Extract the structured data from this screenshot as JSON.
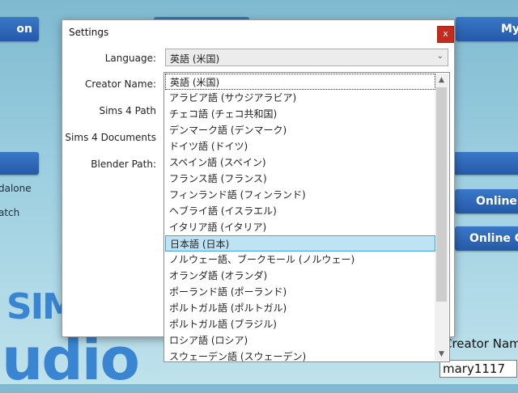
{
  "background": {
    "left_top_button": "on",
    "right_top_button": "My",
    "left_item_1": "dalone",
    "left_item_2": "atch",
    "right_button_1": "Online U",
    "right_button_2": "Online C",
    "logo_top": "SIM",
    "logo_bottom": "udio",
    "creator_label": "Creator Nam",
    "creator_value": "mary1117"
  },
  "dialog": {
    "title": "Settings",
    "close_label": "x",
    "labels": {
      "language": "Language:",
      "creator_name": "Creator Name:",
      "sims4_path": "Sims 4 Path",
      "sims4_documents": "Sims 4 Documents",
      "blender_path": "Blender Path:"
    },
    "language_value": "英語 (米国)",
    "dropdown_arrow": "⌄",
    "options": [
      "英語 (米国)",
      "アラビア語 (サウジアラビア)",
      "チェコ語 (チェコ共和国)",
      "デンマーク語 (デンマーク)",
      "ドイツ語 (ドイツ)",
      "スペイン語 (スペイン)",
      "フランス語 (フランス)",
      "フィンランド語 (フィンランド)",
      "ヘブライ語 (イスラエル)",
      "イタリア語 (イタリア)",
      "日本語 (日本)",
      "ノルウェー語、ブークモール (ノルウェー)",
      "オランダ語 (オランダ)",
      "ポーランド語 (ポーランド)",
      "ポルトガル語 (ポルトガル)",
      "ポルトガル語 (ブラジル)",
      "ロシア語 (ロシア)",
      "スウェーデン語 (スウェーデン)"
    ],
    "selected_index": 10
  },
  "icons": {
    "close": "close-icon",
    "combo_arrow": "chevron-down-icon",
    "scroll_up": "chevron-up-icon",
    "scroll_down": "chevron-down-icon"
  },
  "colors": {
    "close_button": "#c42b1c",
    "selection": "#bde3f4",
    "background_button": "#2d66b8"
  }
}
